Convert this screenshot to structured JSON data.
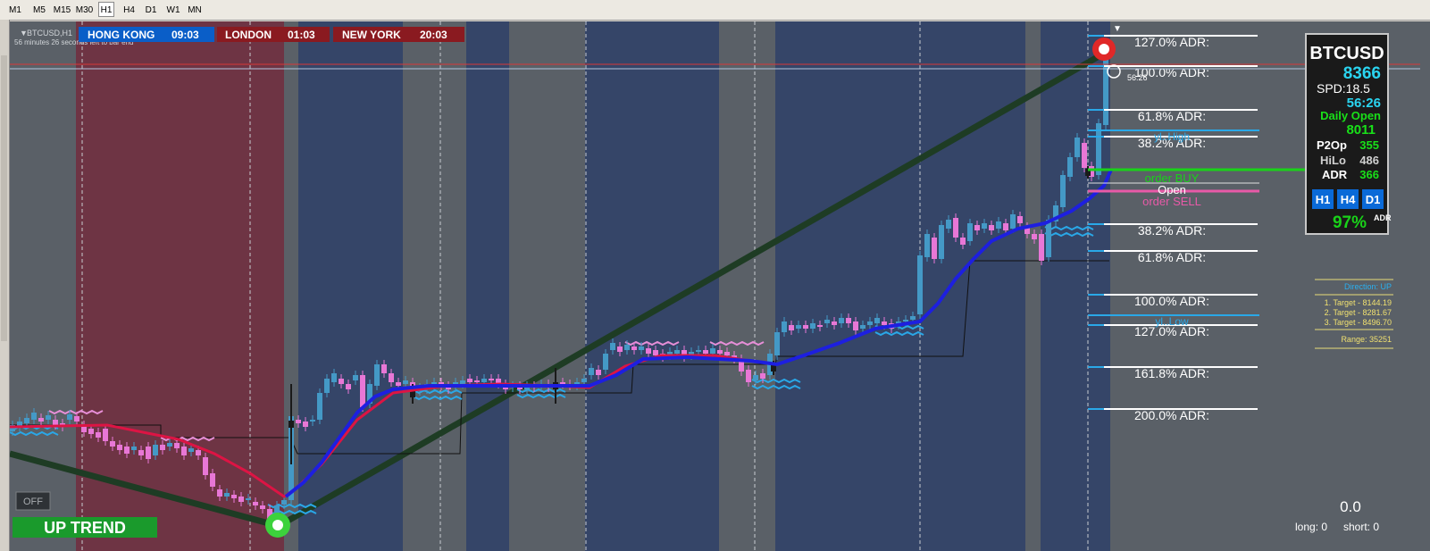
{
  "timeframes": [
    "M1",
    "M5",
    "M15",
    "M30",
    "H1",
    "H4",
    "D1",
    "W1",
    "MN"
  ],
  "active_timeframe": "H1",
  "chart": {
    "symbol_caption": "BTCUSD,H1",
    "bar_countdown": "56 minutes 26 seconds left to bar end",
    "sessions": [
      {
        "name": "HONG KONG",
        "time": "09:03",
        "color": "#0a5ec8"
      },
      {
        "name": "LONDON",
        "time": "01:03",
        "color": "#8a1a20"
      },
      {
        "name": "NEW YORK",
        "time": "20:03",
        "color": "#8a1a20"
      }
    ],
    "adr_levels": [
      "127.0% ADR:",
      "100.0% ADR:",
      "61.8% ADR:",
      "38.2% ADR:",
      "38.2% ADR:",
      "61.8% ADR:",
      "100.0% ADR:",
      "127.0% ADR:",
      "161.8% ADR:",
      "200.0% ADR:"
    ],
    "order_lines": {
      "buy": "order BUY",
      "open": "Open",
      "sell": "order SELL"
    },
    "hl_labels": {
      "high": "yl..High",
      "low": "yl..Low"
    },
    "price_marker": "56:26",
    "trend_label": "UP TREND",
    "off_button": "OFF",
    "bottom": {
      "pl": "0.0",
      "long": "long: 0",
      "short": "short: 0"
    },
    "colors": {
      "bg": "#5a6067",
      "session_red": "#6e3444",
      "session_blue": "#354568",
      "bull": "#4499c6",
      "bear": "#e877d6",
      "ma": "#1d1fe0",
      "trendline": "#1e3c24"
    }
  },
  "info_panel": {
    "symbol": "BTCUSD",
    "price": "8366",
    "spread": "SPD:18.5",
    "timer": "56:26",
    "daily_open_label": "Daily Open",
    "daily_open_value": "8011",
    "rows": [
      {
        "label": "P2Op",
        "value": "355"
      },
      {
        "label": "HiLo",
        "value": "486"
      },
      {
        "label": "ADR",
        "value": "366"
      }
    ],
    "buttons": [
      "H1",
      "H4",
      "D1"
    ],
    "adr_pct": "97%",
    "adr_tag": "ADR"
  },
  "targets_panel": {
    "direction": "Direction: UP",
    "targets": [
      "1. Target - 8144.19",
      "2. Target - 8281.67",
      "3. Target - 8496.70"
    ],
    "range": "Range: 35251"
  }
}
